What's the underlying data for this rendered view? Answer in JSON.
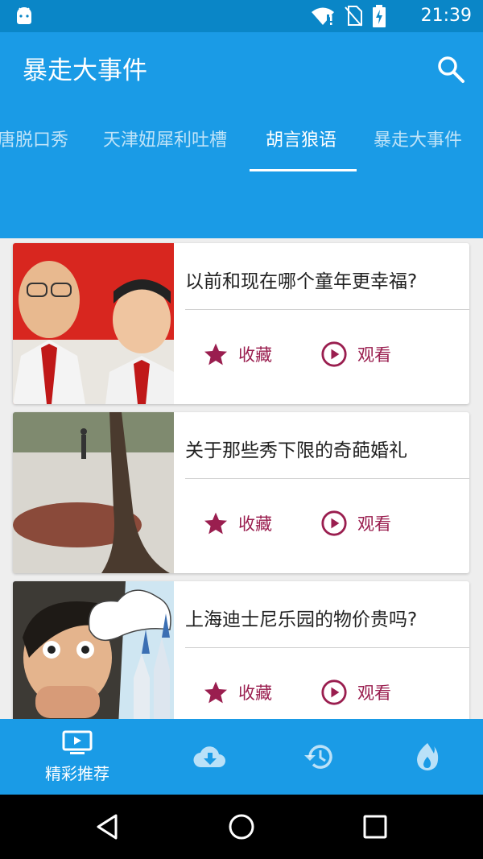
{
  "status_bar": {
    "time": "21:39",
    "icons": [
      "android-icon",
      "wifi-icon",
      "no-sim-icon",
      "battery-charging-icon"
    ]
  },
  "header": {
    "title": "暴走大事件",
    "search_icon": "search-icon"
  },
  "tabs": [
    {
      "label": "唐脱口秀",
      "active": false
    },
    {
      "label": "天津妞犀利吐槽",
      "active": false
    },
    {
      "label": "胡言狼语",
      "active": true
    },
    {
      "label": "暴走大事件",
      "active": false
    }
  ],
  "cards": [
    {
      "title": "以前和现在哪个童年更幸福?",
      "fav_label": "收藏",
      "watch_label": "观看"
    },
    {
      "title": "关于那些秀下限的奇葩婚礼",
      "fav_label": "收藏",
      "watch_label": "观看"
    },
    {
      "title": "上海迪士尼乐园的物价贵吗?",
      "fav_label": "收藏",
      "watch_label": "观看"
    }
  ],
  "bottom_nav": {
    "items": [
      {
        "label": "精彩推荐",
        "icon": "tv-play-icon",
        "active": true
      },
      {
        "label": "",
        "icon": "cloud-download-icon",
        "active": false
      },
      {
        "label": "",
        "icon": "history-icon",
        "active": false
      },
      {
        "label": "",
        "icon": "fire-icon",
        "active": false
      }
    ]
  },
  "colors": {
    "status_bar": "#0a86c7",
    "primary": "#1a9be6",
    "accent": "#9a1e4f",
    "background": "#eeeeee"
  }
}
